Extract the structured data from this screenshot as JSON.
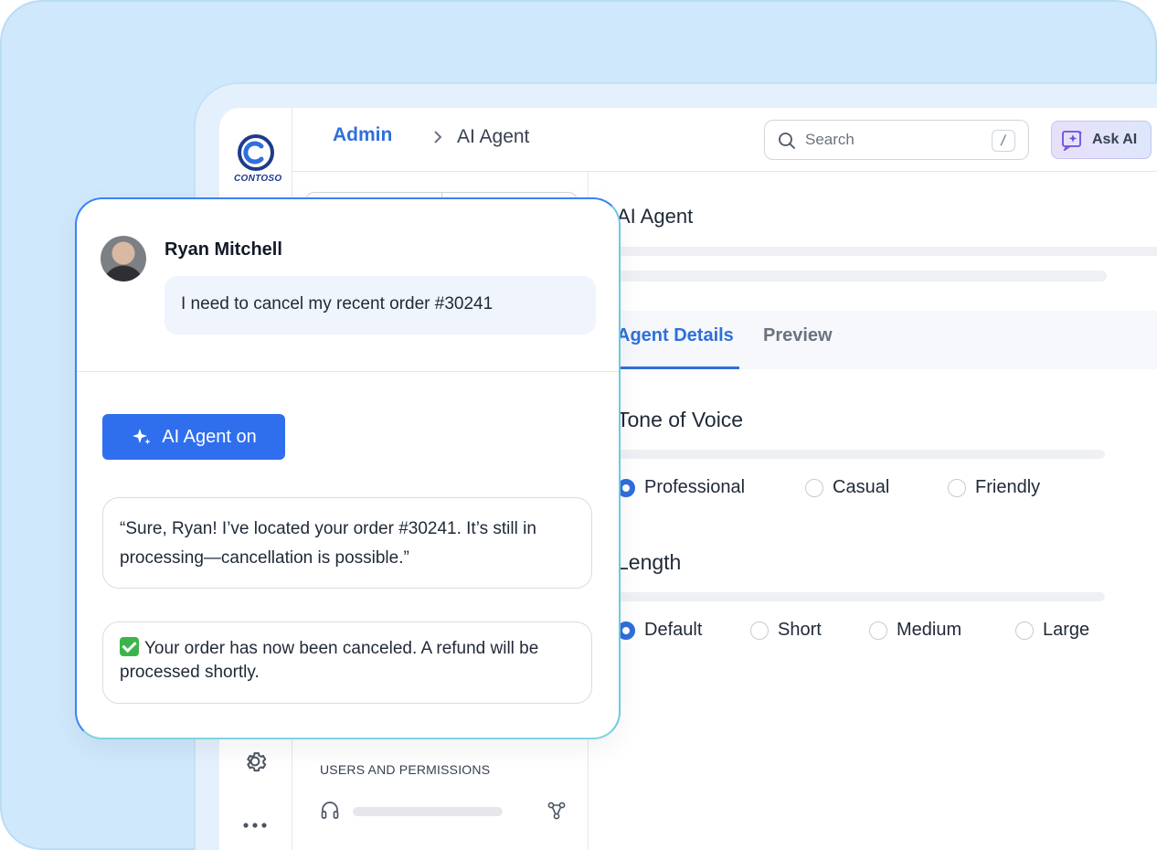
{
  "brand": {
    "logo_text": "CONTOSO"
  },
  "breadcrumb": {
    "root": "Admin",
    "current": "AI Agent"
  },
  "search": {
    "placeholder": "Search",
    "shortcut": "/"
  },
  "ask_ai": {
    "label": "Ask AI"
  },
  "main": {
    "title": "AI Agent",
    "tabs": [
      {
        "label": "Agent Details",
        "active": true
      },
      {
        "label": "Preview",
        "active": false
      }
    ],
    "tone": {
      "title": "Tone of Voice",
      "options": [
        "Professional",
        "Casual",
        "Friendly"
      ],
      "selected": "Professional"
    },
    "length": {
      "title": "Length",
      "options": [
        "Default",
        "Short",
        "Medium",
        "Large"
      ],
      "selected": "Default"
    }
  },
  "nav": {
    "section_label": "USERS AND PERMISSIONS"
  },
  "chat": {
    "user_name": "Ryan Mitchell",
    "user_message": "I need to cancel my recent order #30241",
    "ai_toggle_label": "AI Agent on",
    "replies": [
      "“Sure, Ryan! I’ve located your order #30241. It’s still in processing—cancellation is possible.”",
      "Your order has now been canceled. A refund will be processed shortly."
    ]
  },
  "colors": {
    "accent": "#2f6fdc",
    "button": "#2f6fed",
    "frame_bg": "#cfe8fb",
    "success": "#3bb54a"
  }
}
